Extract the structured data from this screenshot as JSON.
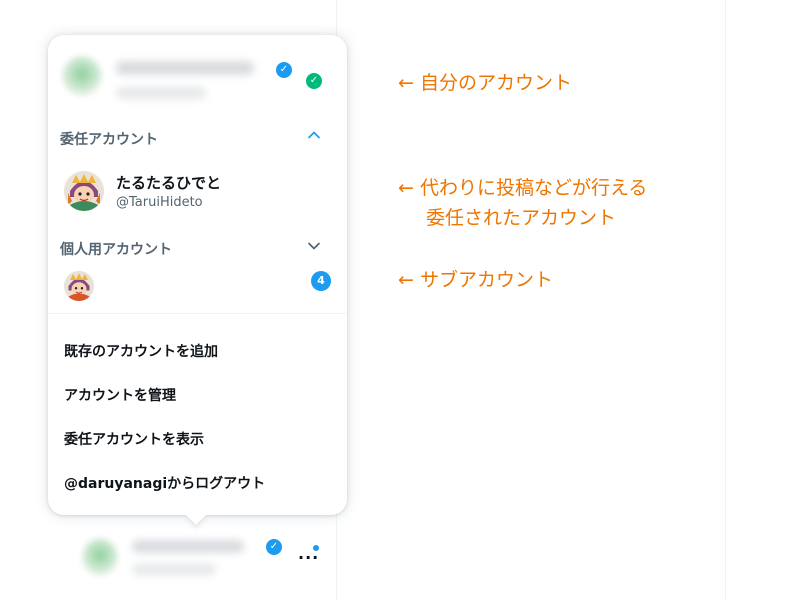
{
  "popup": {
    "delegate_section": {
      "title": "委任アカウント",
      "account": {
        "name": "たるたるひでと",
        "handle": "@TaruiHideto"
      }
    },
    "personal_section": {
      "title": "個人用アカウント",
      "badge_count": "4"
    },
    "menu": [
      {
        "label": "既存のアカウントを追加"
      },
      {
        "label": "アカウントを管理"
      },
      {
        "label": "委任アカウントを表示"
      },
      {
        "label": "@daruyanagiからログアウト"
      }
    ]
  },
  "annotations": {
    "own_account": "← 自分のアカウント",
    "delegated_line1": "← 代わりに投稿などが行える",
    "delegated_line2": "委任されたアカウント",
    "sub_account": "← サブアカウント"
  },
  "colors": {
    "accent": "#1d9bf0",
    "annotation": "#ee7500",
    "success": "#00ba7c"
  },
  "icons": {
    "verified": "verified-badge-icon",
    "active": "check-circle-icon",
    "expand_up": "chevron-up-icon",
    "expand_down": "chevron-down-icon",
    "more": "more-dots-icon"
  }
}
